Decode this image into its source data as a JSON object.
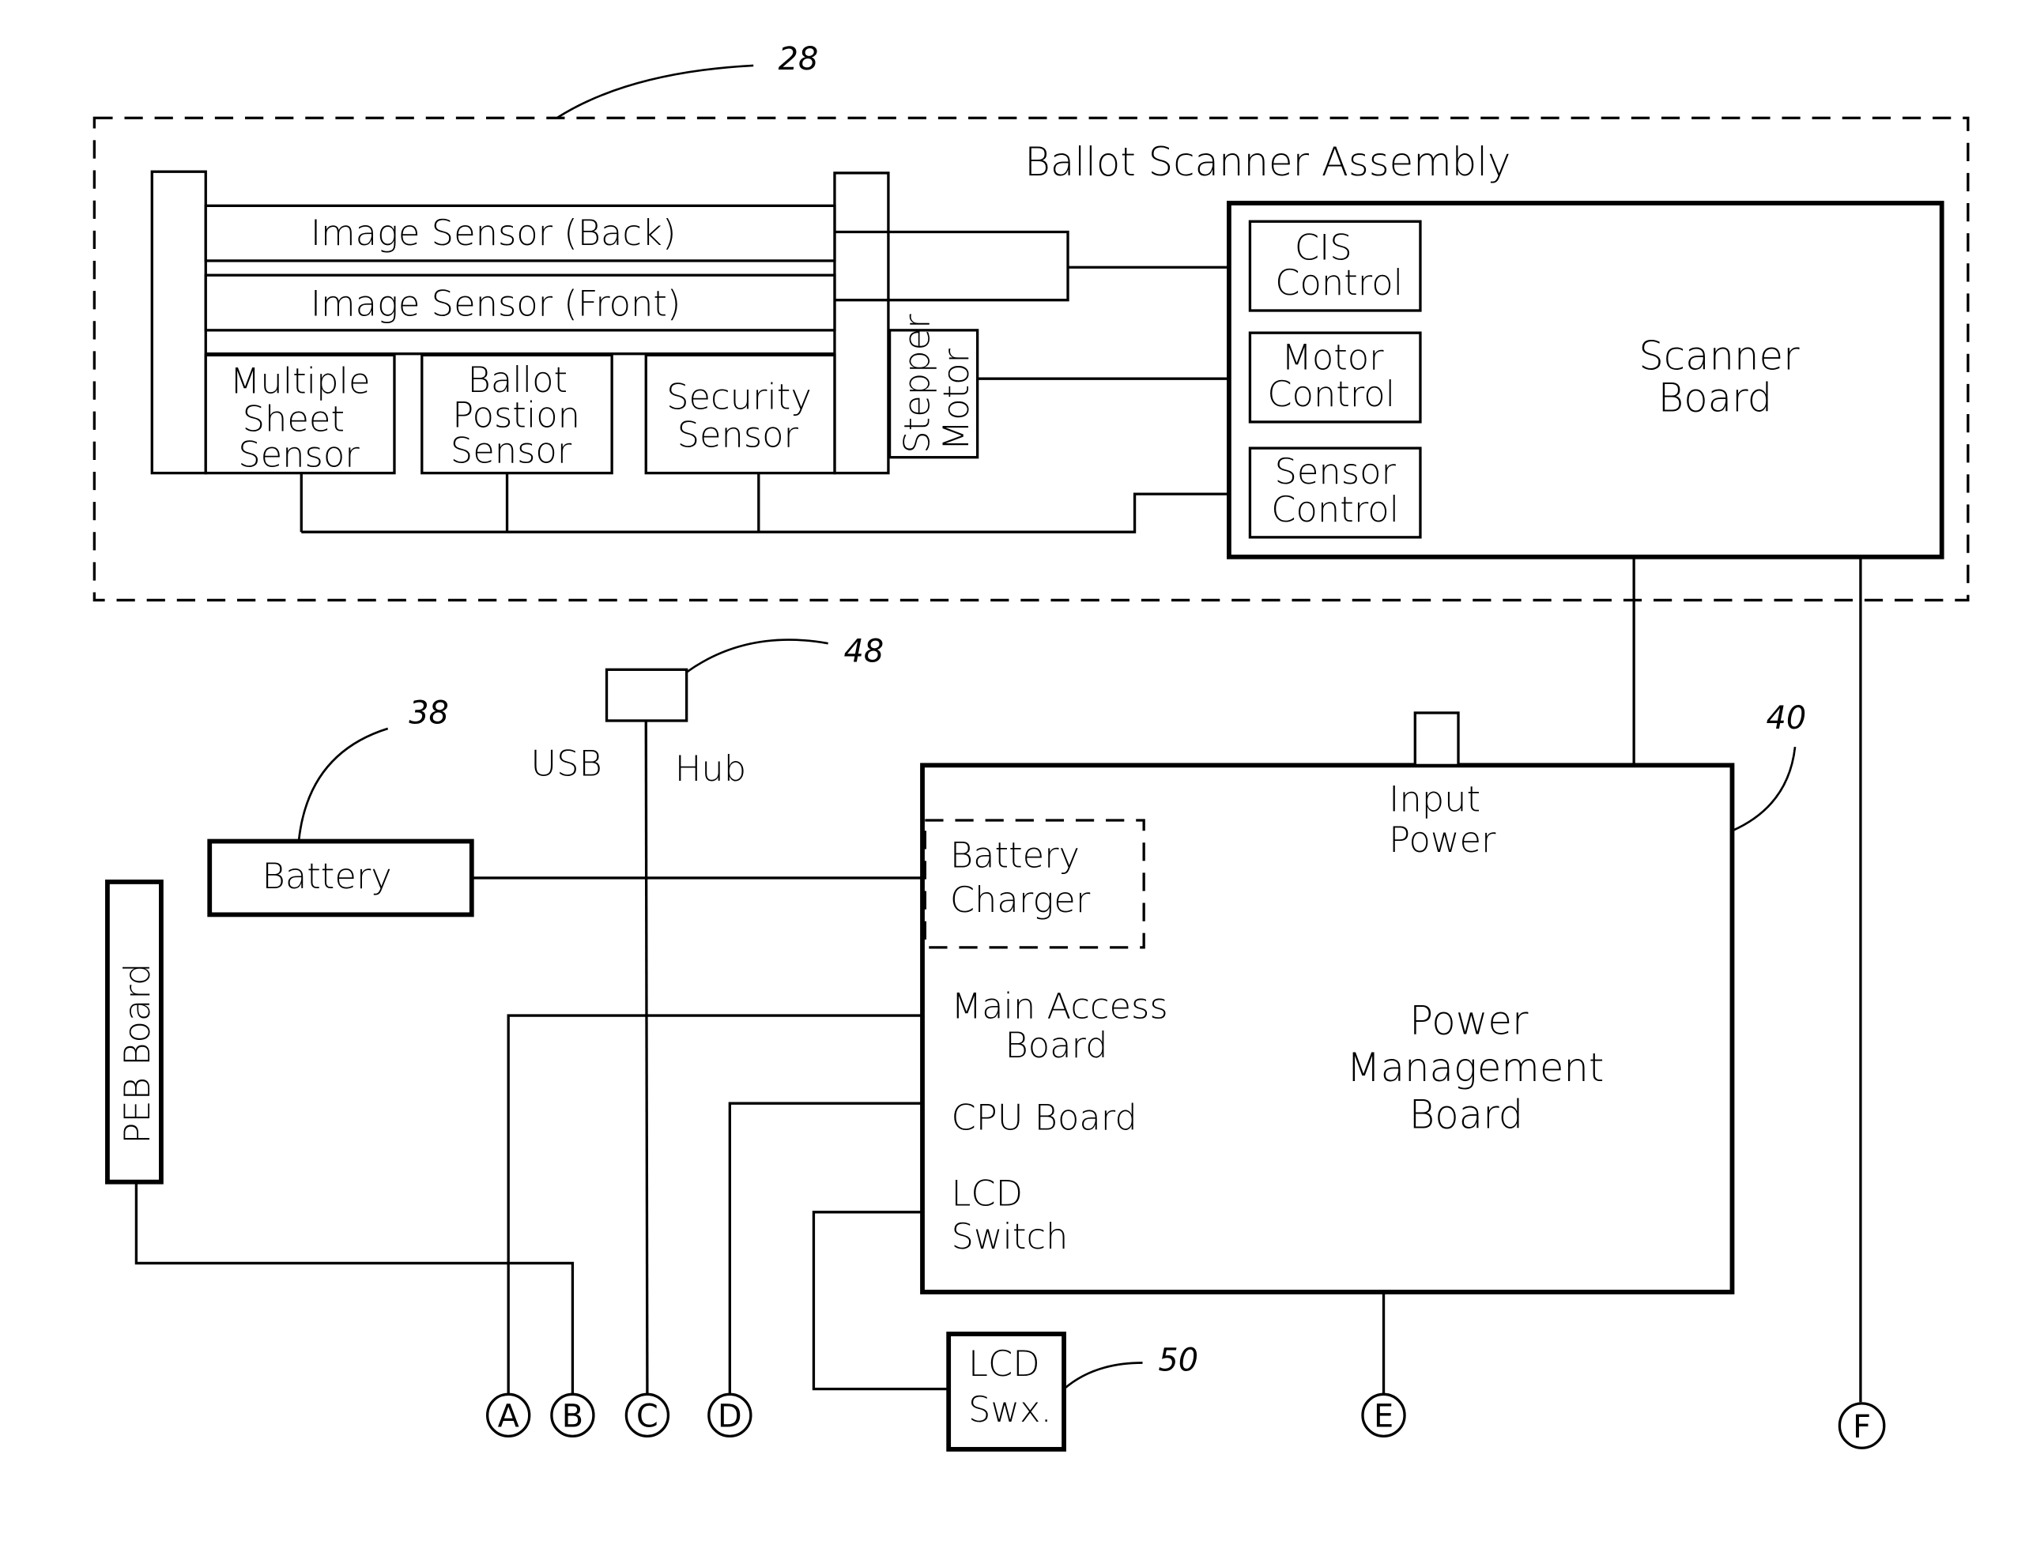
{
  "figure": {
    "reference_numerals": {
      "assembly": "28",
      "battery": "38",
      "power_board": "40",
      "usb_hub": "48",
      "lcd_switch": "50"
    },
    "scanner_assembly": {
      "title": "Ballot Scanner Assembly",
      "image_sensor_back": "Image Sensor (Back)",
      "image_sensor_front": "Image Sensor (Front)",
      "multiple_sheet_sensor": [
        "Multiple",
        "Sheet",
        "Sensor"
      ],
      "ballot_position_sensor": [
        "Ballot",
        "Postion",
        "Sensor"
      ],
      "security_sensor": [
        "Security",
        "Sensor"
      ],
      "stepper_motor": [
        "Stepper",
        "Motor"
      ],
      "scanner_board": [
        "Scanner",
        "Board"
      ],
      "cis_control": [
        "CIS",
        "Control"
      ],
      "motor_control": [
        "Motor",
        "Control"
      ],
      "sensor_control": [
        "Sensor",
        "Control"
      ]
    },
    "usb_hub": {
      "left_label": "USB",
      "right_label": "Hub"
    },
    "battery": "Battery",
    "peb_board": "PEB Board",
    "power_management": {
      "title": [
        "Power",
        "Management",
        "Board"
      ],
      "input_power": [
        "Input",
        "Power"
      ],
      "battery_charger": [
        "Battery",
        "Charger"
      ],
      "main_access_board": [
        "Main Access",
        "Board"
      ],
      "cpu_board": "CPU Board",
      "lcd_switch": [
        "LCD",
        "Switch"
      ]
    },
    "lcd_swx": [
      "LCD",
      "Swx."
    ],
    "connectors": [
      "A",
      "B",
      "C",
      "D",
      "E",
      "F"
    ]
  }
}
